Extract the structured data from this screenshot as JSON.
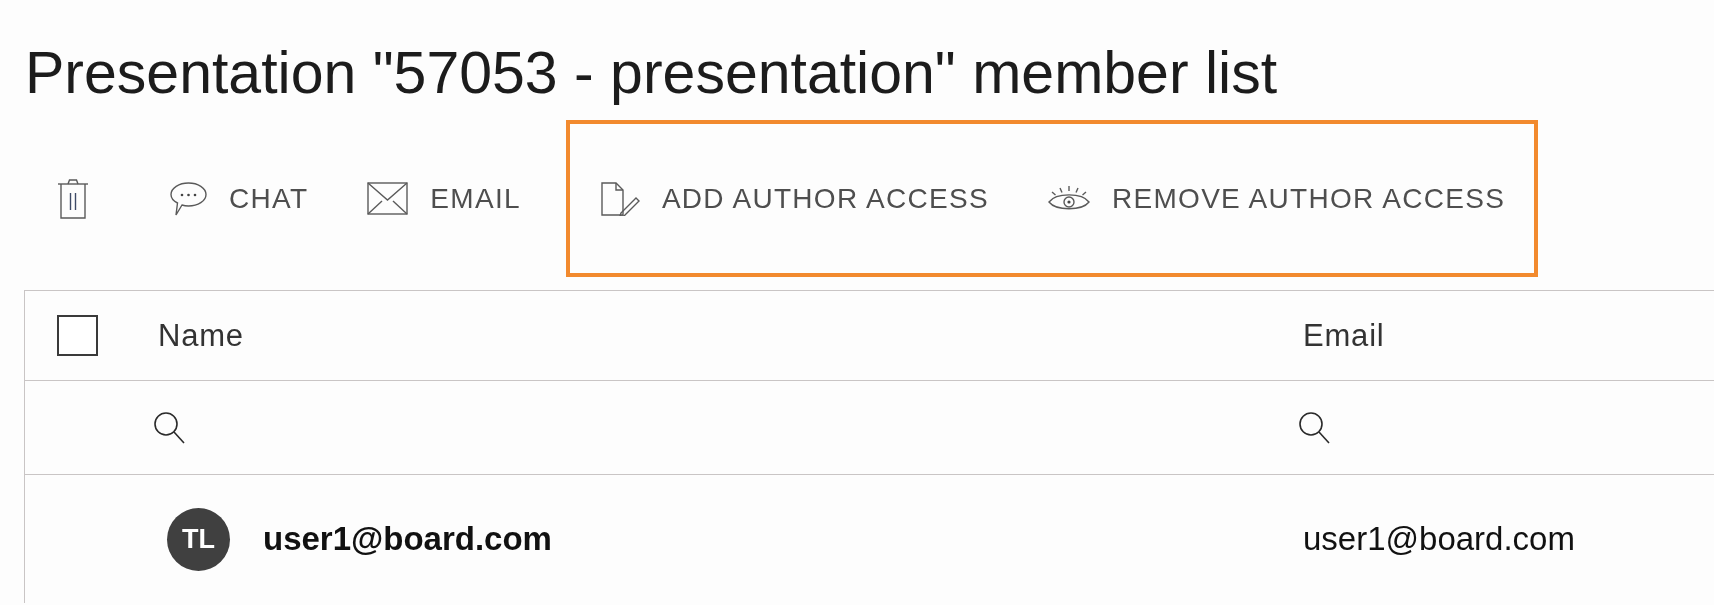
{
  "page": {
    "title": "Presentation \"57053 - presentation\" member list"
  },
  "toolbar": {
    "groups": [
      {
        "highlighted": false,
        "actions": [
          {
            "kind": "delete"
          },
          {
            "kind": "chat",
            "label": "CHAT"
          },
          {
            "kind": "email",
            "label": "EMAIL"
          }
        ]
      },
      {
        "highlighted": true,
        "actions": [
          {
            "kind": "add_author",
            "label": "ADD AUTHOR ACCESS"
          },
          {
            "kind": "remove_author",
            "label": "REMOVE AUTHOR ACCESS"
          }
        ]
      }
    ]
  },
  "table": {
    "select_all": {
      "checked": false
    },
    "columns": [
      {
        "label": "Name",
        "filterable": true
      },
      {
        "label": "Email",
        "filterable": true
      }
    ],
    "rows": [
      {
        "initials": "TL",
        "name": "user1@board.com",
        "email": "user1@board.com"
      }
    ]
  }
}
